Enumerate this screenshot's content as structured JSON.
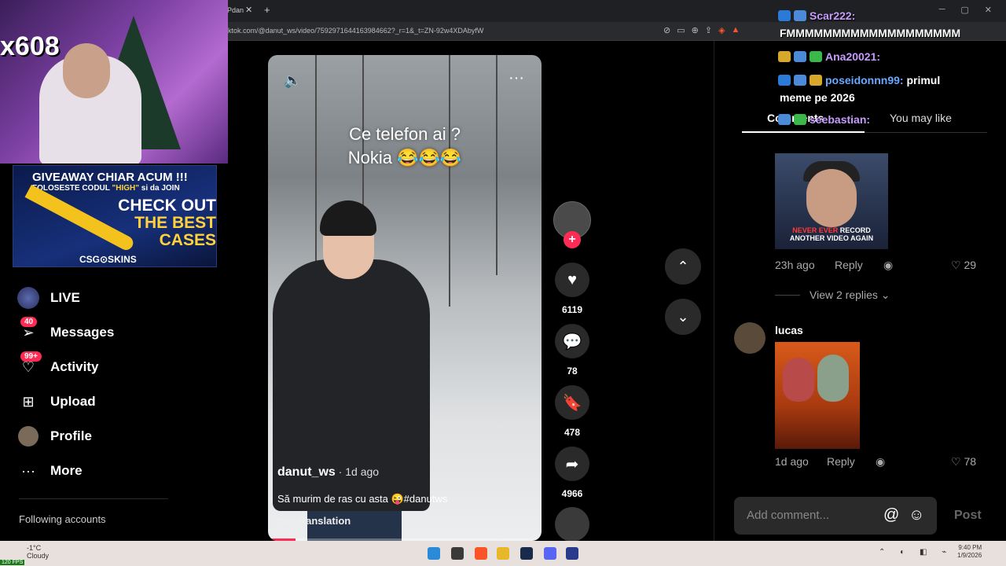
{
  "browser": {
    "tab_title": "Pdan",
    "url": "ktok.com/@danut_ws/video/7592971644163984662?_r=1&_t=ZN-92w4XDAbyfW"
  },
  "overlay": {
    "webcam_number": "x608",
    "giveaway": {
      "title": "GIVEAWAY CHIAR ACUM !!!",
      "subtitle_prefix": "FOLOSESTE CODUL ",
      "code": "\"HIGH\"",
      "subtitle_suffix": " si da JOIN",
      "cta_line1": "CHECK OUT",
      "cta_line2": "THE BEST",
      "cta_line3": "CASES",
      "brand": "CSG⊙SKINS"
    }
  },
  "sidebar": {
    "items": [
      {
        "label": "LIVE",
        "icon": "live-icon"
      },
      {
        "label": "Messages",
        "icon": "paper-plane-icon",
        "badge": "40"
      },
      {
        "label": "Activity",
        "icon": "heart-icon",
        "badge": "99+"
      },
      {
        "label": "Upload",
        "icon": "plus-square-icon"
      },
      {
        "label": "Profile",
        "icon": "avatar-icon"
      },
      {
        "label": "More",
        "icon": "ellipsis-icon"
      }
    ],
    "following_header": "Following accounts"
  },
  "video": {
    "overlay_line1": "Ce telefon ai ?",
    "overlay_line2": "Nokia 😂😂😂",
    "author": "danut_ws",
    "time": " · 1d ago",
    "caption": "Să murim de ras cu asta 😜#danutws",
    "see_translation": "See translation",
    "progress": 0.1
  },
  "actions": {
    "likes": "6119",
    "comments": "78",
    "saves": "478",
    "shares": "4966"
  },
  "comments_panel": {
    "tab_comments": "Comments",
    "tab_like": "You may like",
    "comment1": {
      "image_text_red": "NEVER EVER",
      "image_text_rest": " RECORD ANOTHER VIDEO AGAIN",
      "time": "23h ago",
      "reply": "Reply",
      "likes": "29"
    },
    "view_replies": "View 2 replies",
    "comment2": {
      "author": "lucas",
      "time": "1d ago",
      "reply": "Reply",
      "likes": "78"
    },
    "add_comment_placeholder": "Add comment...",
    "post": "Post"
  },
  "chat": {
    "line1_name": "Scar222:",
    "line1_msg": "FMMMMMMMMMMMMMMMMMMM",
    "line2_name": "Ana20021:",
    "line3_name": "poseidonnn99:",
    "line3_msg": " primul",
    "line3_msg2": "meme pe 2026",
    "line4_name": "seebastian:"
  },
  "taskbar": {
    "weather_temp": "-1°C",
    "weather_desc": "Cloudy",
    "time": "9:40 PM",
    "date": "1/9/2026",
    "fps": "120 FPS"
  }
}
